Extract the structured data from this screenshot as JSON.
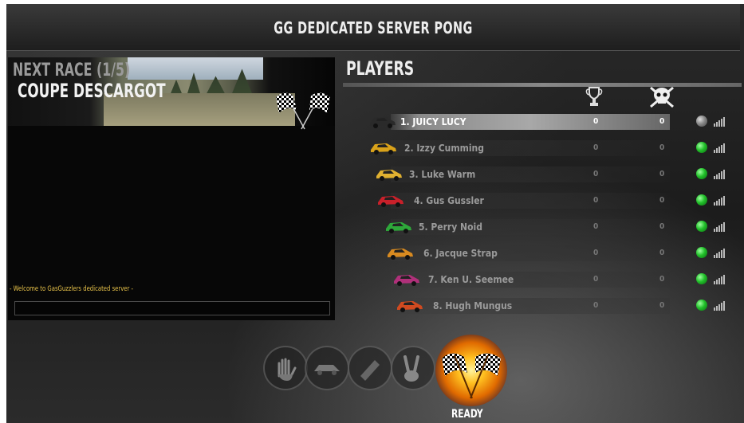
{
  "window": {
    "title": "GG DEDICATED SERVER PONG"
  },
  "race": {
    "next_label": "NEXT RACE (1/5)",
    "name": "COUPE DESCARGOT"
  },
  "chat": {
    "welcome": "- Welcome to GasGuzzlers dedicated server -",
    "input_value": ""
  },
  "players": {
    "title": "PLAYERS",
    "columns": {
      "wins_icon": "trophy-icon",
      "kills_icon": "skull-icon"
    },
    "rows": [
      {
        "name": "1. JUICY LUCY",
        "wins": "0",
        "deaths": "0",
        "status": "grey",
        "car_color": "#2a2a2a",
        "active": true
      },
      {
        "name": "2. Izzy Cumming",
        "wins": "0",
        "deaths": "0",
        "status": "green",
        "car_color": "#d9a21a"
      },
      {
        "name": "3. Luke Warm",
        "wins": "0",
        "deaths": "0",
        "status": "green",
        "car_color": "#e0b030"
      },
      {
        "name": "4. Gus Gussler",
        "wins": "0",
        "deaths": "0",
        "status": "green",
        "car_color": "#c8202a"
      },
      {
        "name": "5. Perry Noid",
        "wins": "0",
        "deaths": "0",
        "status": "green",
        "car_color": "#2ea83a"
      },
      {
        "name": "6. Jacque Strap",
        "wins": "0",
        "deaths": "0",
        "status": "green",
        "car_color": "#d88a20"
      },
      {
        "name": "7. Ken U. Seemee",
        "wins": "0",
        "deaths": "0",
        "status": "green",
        "car_color": "#b0307a"
      },
      {
        "name": "8. Hugh Mungus",
        "wins": "0",
        "deaths": "0",
        "status": "green",
        "car_color": "#d04a20"
      }
    ]
  },
  "actions": {
    "buttons": [
      {
        "icon": "hand-icon"
      },
      {
        "icon": "car-icon"
      },
      {
        "icon": "paint-icon"
      },
      {
        "icon": "peace-hand-icon"
      }
    ],
    "ready_label": "READY"
  }
}
